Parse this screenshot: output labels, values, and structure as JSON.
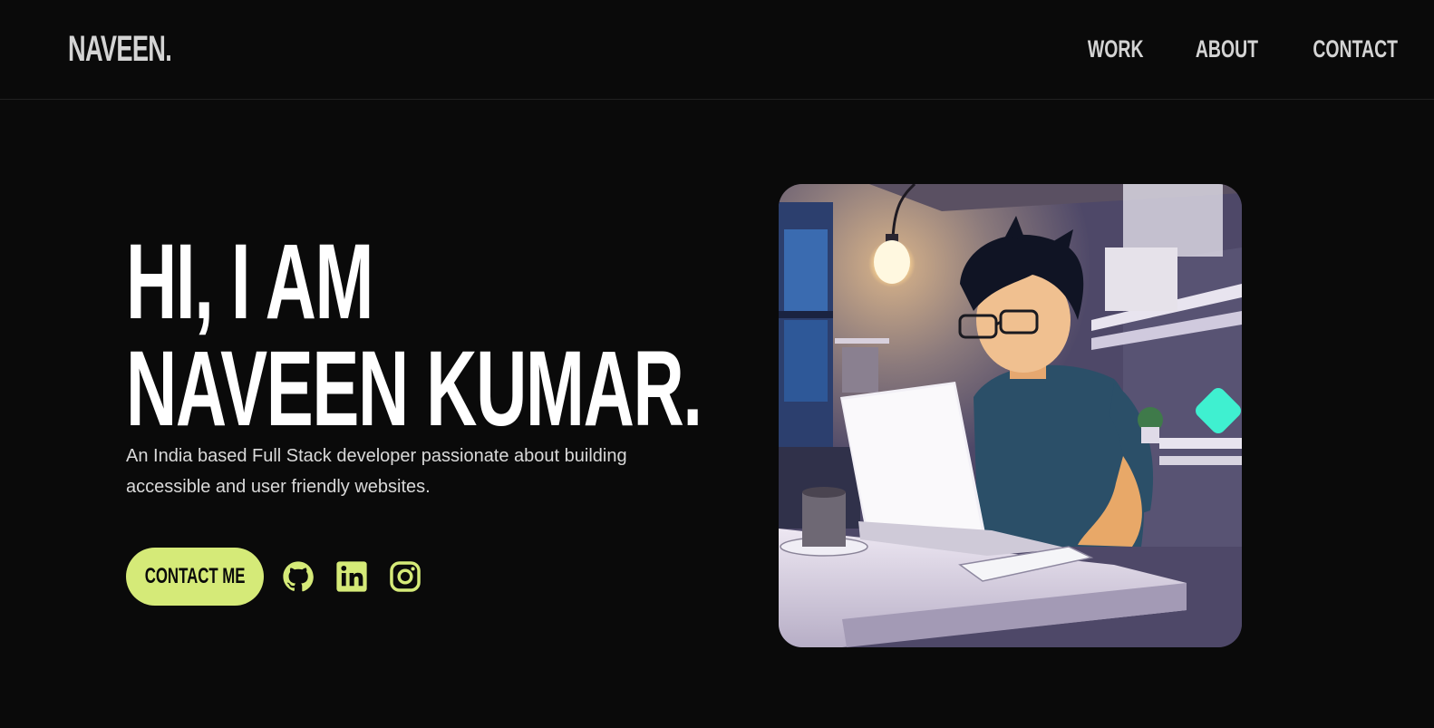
{
  "header": {
    "logo": "NAVEEN.",
    "nav": [
      {
        "label": "WORK"
      },
      {
        "label": "ABOUT"
      },
      {
        "label": "CONTACT"
      }
    ]
  },
  "hero": {
    "title_line1": "HI, I AM",
    "title_line2": "NAVEEN KUMAR.",
    "description": "An India based Full Stack developer passionate about building accessible and user friendly websites.",
    "cta_label": "CONTACT ME",
    "socials": [
      {
        "icon": "github-icon"
      },
      {
        "icon": "linkedin-icon"
      },
      {
        "icon": "instagram-icon"
      }
    ]
  },
  "colors": {
    "background": "#0a0a0a",
    "accent": "#d5ea78",
    "nav_text": "#d4d4d4",
    "body_text": "#d9d9d9"
  }
}
